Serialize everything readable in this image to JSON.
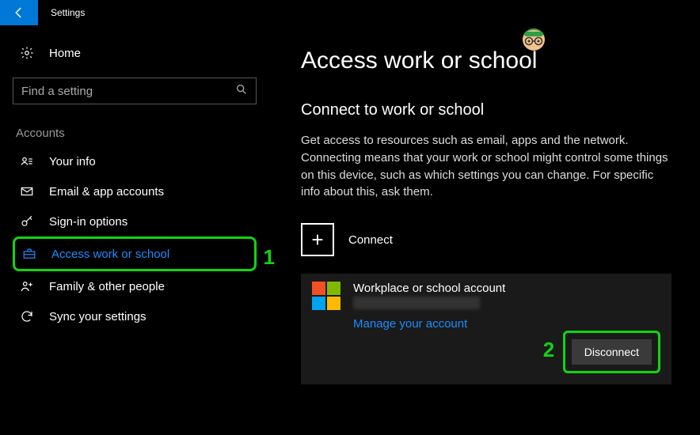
{
  "titlebar": {
    "title": "Settings"
  },
  "sidebar": {
    "home": "Home",
    "search_placeholder": "Find a setting",
    "section": "Accounts",
    "items": [
      {
        "label": "Your info"
      },
      {
        "label": "Email & app accounts"
      },
      {
        "label": "Sign-in options"
      },
      {
        "label": "Access work or school"
      },
      {
        "label": "Family & other people"
      },
      {
        "label": "Sync your settings"
      }
    ]
  },
  "main": {
    "title": "Access work or school",
    "subtitle": "Connect to work or school",
    "description": "Get access to resources such as email, apps and the network. Connecting means that your work or school might control some things on this device, such as which settings you can change. For specific info about this, ask them.",
    "connect_label": "Connect",
    "account": {
      "name": "Workplace or school account",
      "manage": "Manage your account",
      "disconnect": "Disconnect"
    }
  },
  "annotations": {
    "one": "1",
    "two": "2"
  }
}
